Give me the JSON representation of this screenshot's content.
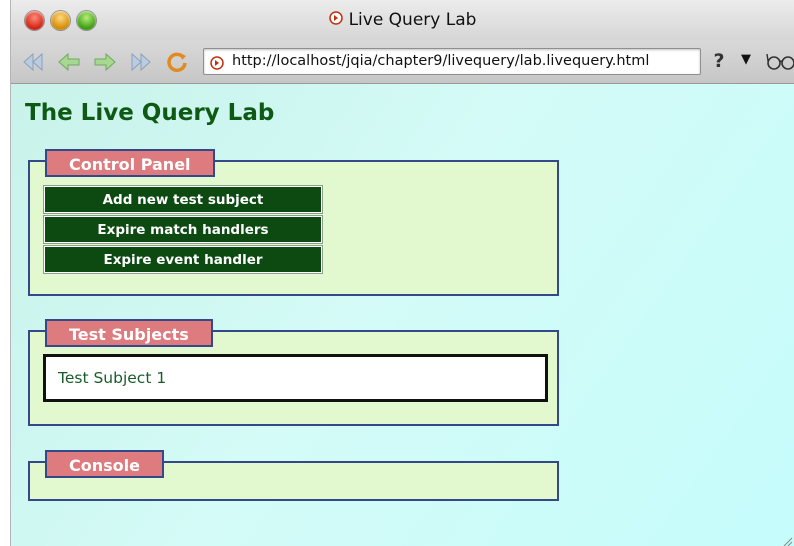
{
  "window": {
    "title": "Live Query Lab"
  },
  "toolbar": {
    "url": "http://localhost/jqia/chapter9/livequery/lab.livequery.html",
    "help_label": "?",
    "dropdown_label": "▼"
  },
  "page": {
    "title": "The Live Query Lab",
    "control_panel": {
      "legend": "Control Panel",
      "buttons": [
        {
          "label": "Add new test subject"
        },
        {
          "label": "Expire match handlers"
        },
        {
          "label": "Expire event handler"
        }
      ]
    },
    "test_subjects": {
      "legend": "Test Subjects",
      "items": [
        {
          "label": "Test Subject 1"
        }
      ]
    },
    "console": {
      "legend": "Console"
    }
  },
  "colors": {
    "page_title": "#0e5a14",
    "legend_bg": "#dd7b7f",
    "fieldset_bg": "#e2f9d0",
    "fieldset_border": "#33498a",
    "button_bg": "#0c4a12",
    "viewport_bg": "#c8f2ea"
  },
  "icons": {
    "back": "back-icon",
    "forward": "forward-icon",
    "reload": "reload-icon",
    "page": "page-icon",
    "glasses": "glasses-icon"
  }
}
